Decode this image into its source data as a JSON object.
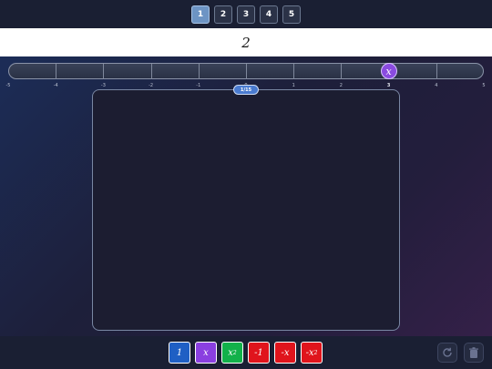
{
  "pages": [
    "1",
    "2",
    "3",
    "4",
    "5"
  ],
  "active_page": 0,
  "expression": "2",
  "number_line": {
    "ticks": [
      "-5",
      "-4",
      "-3",
      "-2",
      "-1",
      "0",
      "1",
      "2",
      "3",
      "4",
      "5"
    ],
    "min": -5,
    "max": 5,
    "marker_value": 3,
    "marker_label": "x"
  },
  "score": "1/15",
  "tiles": [
    {
      "label": "1",
      "sup": "",
      "color": "#1f5fc4"
    },
    {
      "label": "x",
      "sup": "",
      "color": "#8a3fe0"
    },
    {
      "label": "x",
      "sup": "2",
      "color": "#12b14a"
    },
    {
      "label": "-1",
      "sup": "",
      "color": "#e0141c"
    },
    {
      "label": "-x",
      "sup": "",
      "color": "#e0141c"
    },
    {
      "label": "-x",
      "sup": "2",
      "color": "#e0141c"
    }
  ],
  "tools": {
    "reset_icon": "reset-icon",
    "trash_icon": "trash-icon"
  }
}
